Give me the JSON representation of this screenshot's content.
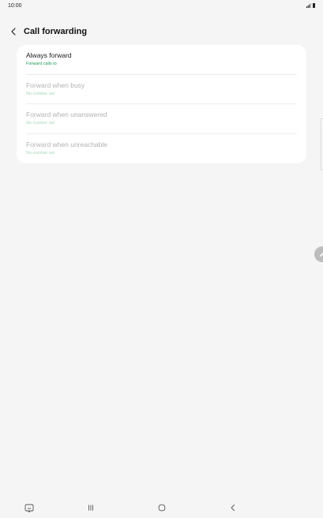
{
  "status_bar": {
    "time": "10:00",
    "icons": [
      "signal-icon",
      "battery-icon"
    ]
  },
  "header": {
    "title": "Call forwarding",
    "back_icon": "chevron-left-icon"
  },
  "forwarding_options": [
    {
      "title": "Always forward",
      "subtitle": "Forward calls to",
      "enabled": true
    },
    {
      "title": "Forward when busy",
      "subtitle": "No number set",
      "enabled": false
    },
    {
      "title": "Forward when unanswered",
      "subtitle": "No number set",
      "enabled": false
    },
    {
      "title": "Forward when unreachable",
      "subtitle": "No number set",
      "enabled": false
    }
  ],
  "floating": {
    "edit_icon": "pencil-icon"
  },
  "nav_bar": {
    "buttons": [
      "keyboard-icon",
      "recent-apps-icon",
      "home-icon",
      "back-icon"
    ]
  },
  "colors": {
    "accent_green": "#1e9e56",
    "background": "#f5f5f5",
    "card": "#ffffff"
  }
}
